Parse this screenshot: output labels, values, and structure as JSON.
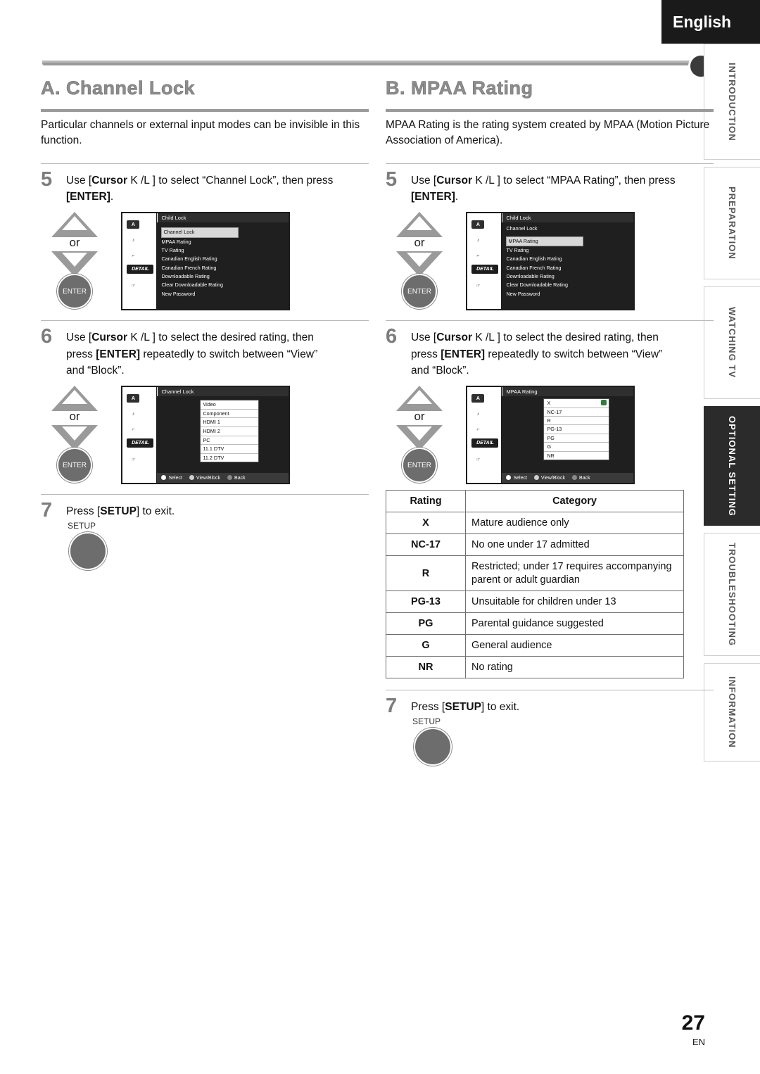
{
  "header": {
    "language": "English"
  },
  "side_tabs": [
    {
      "label": "INTRODUCTION",
      "active": false
    },
    {
      "label": "PREPARATION",
      "active": false
    },
    {
      "label": "WATCHING TV",
      "active": false
    },
    {
      "label": "OPTIONAL SETTING",
      "active": true
    },
    {
      "label": "TROUBLESHOOTING",
      "active": false
    },
    {
      "label": "INFORMATION",
      "active": false
    }
  ],
  "left": {
    "title": "A.  Channel Lock",
    "intro": "Particular channels or external input modes can be invisible in this function.",
    "step5": {
      "num": "5",
      "text_1": "Use [",
      "cursor": "Cursor",
      "text_2": " K /L ] to select “Channel Lock”, then press ",
      "enter": "[ENTER]",
      "text_3": "."
    },
    "step6": {
      "num": "6",
      "line1_a": "Use [",
      "cursor": "Cursor",
      "line1_b": " K /L ] to select the desired rating, then",
      "line2_a": "press ",
      "enter": "[ENTER]",
      "line2_b": " repeatedly to switch between “View”",
      "line3": "and “Block”."
    },
    "step7": {
      "num": "7",
      "text_a": "Press [",
      "setup": "SETUP",
      "text_b": "] to exit.",
      "button_label": "SETUP"
    },
    "or": "or",
    "enter_button": "ENTER",
    "tv1": {
      "title": "Child Lock",
      "items": [
        "Channel Lock",
        "MPAA Rating",
        "TV Rating",
        "Canadian English Rating",
        "Canadian French Rating",
        "Downloadable Rating",
        "Clear Downloadable Rating",
        "New Password"
      ],
      "selected_index": 0,
      "detail_label": "DETAIL"
    },
    "tv2": {
      "title": "Channel Lock",
      "items": [
        "Video",
        "Component",
        "HDMI 1",
        "HDMI 2",
        "PC",
        "11.1 DTV",
        "11.2 DTV"
      ],
      "detail_label": "DETAIL",
      "footer": [
        "Select",
        "View/Block",
        "Back"
      ]
    }
  },
  "right": {
    "title": "B.  MPAA Rating",
    "intro": "MPAA Rating is the rating system created by MPAA (Motion Picture Association of America).",
    "step5": {
      "num": "5",
      "text_1": "Use [",
      "cursor": "Cursor",
      "text_2": " K /L ] to select “MPAA Rating”, then press ",
      "enter": "[ENTER]",
      "text_3": "."
    },
    "step6": {
      "num": "6",
      "line1_a": "Use [",
      "cursor": "Cursor",
      "line1_b": " K /L ] to select the desired rating, then",
      "line2_a": "press ",
      "enter": "[ENTER]",
      "line2_b": " repeatedly to switch between “View”",
      "line3": "and “Block”."
    },
    "step7": {
      "num": "7",
      "text_a": "Press [",
      "setup": "SETUP",
      "text_b": "] to exit.",
      "button_label": "SETUP"
    },
    "or": "or",
    "enter_button": "ENTER",
    "tv1": {
      "title": "Child Lock",
      "items": [
        "Channel Lock",
        "MPAA Rating",
        "TV Rating",
        "Canadian English Rating",
        "Canadian French Rating",
        "Downloadable Rating",
        "Clear Downloadable Rating",
        "New Password"
      ],
      "selected_index": 1,
      "detail_label": "DETAIL"
    },
    "tv2": {
      "title": "MPAA Rating",
      "items": [
        "X",
        "NC-17",
        "R",
        "PG-13",
        "PG",
        "G",
        "NR"
      ],
      "detail_label": "DETAIL",
      "footer": [
        "Select",
        "View/Block",
        "Back"
      ]
    },
    "table": {
      "headers": [
        "Rating",
        "Category"
      ],
      "rows": [
        {
          "rating": "X",
          "category": "Mature audience only"
        },
        {
          "rating": "NC-17",
          "category": "No one under 17 admitted"
        },
        {
          "rating": "R",
          "category": "Restricted; under 17 requires accompanying parent or adult guardian"
        },
        {
          "rating": "PG-13",
          "category": "Unsuitable for children under 13"
        },
        {
          "rating": "PG",
          "category": "Parental guidance suggested"
        },
        {
          "rating": "G",
          "category": "General audience"
        },
        {
          "rating": "NR",
          "category": "No rating"
        }
      ]
    }
  },
  "footer": {
    "page_number": "27",
    "page_suffix": "EN"
  }
}
